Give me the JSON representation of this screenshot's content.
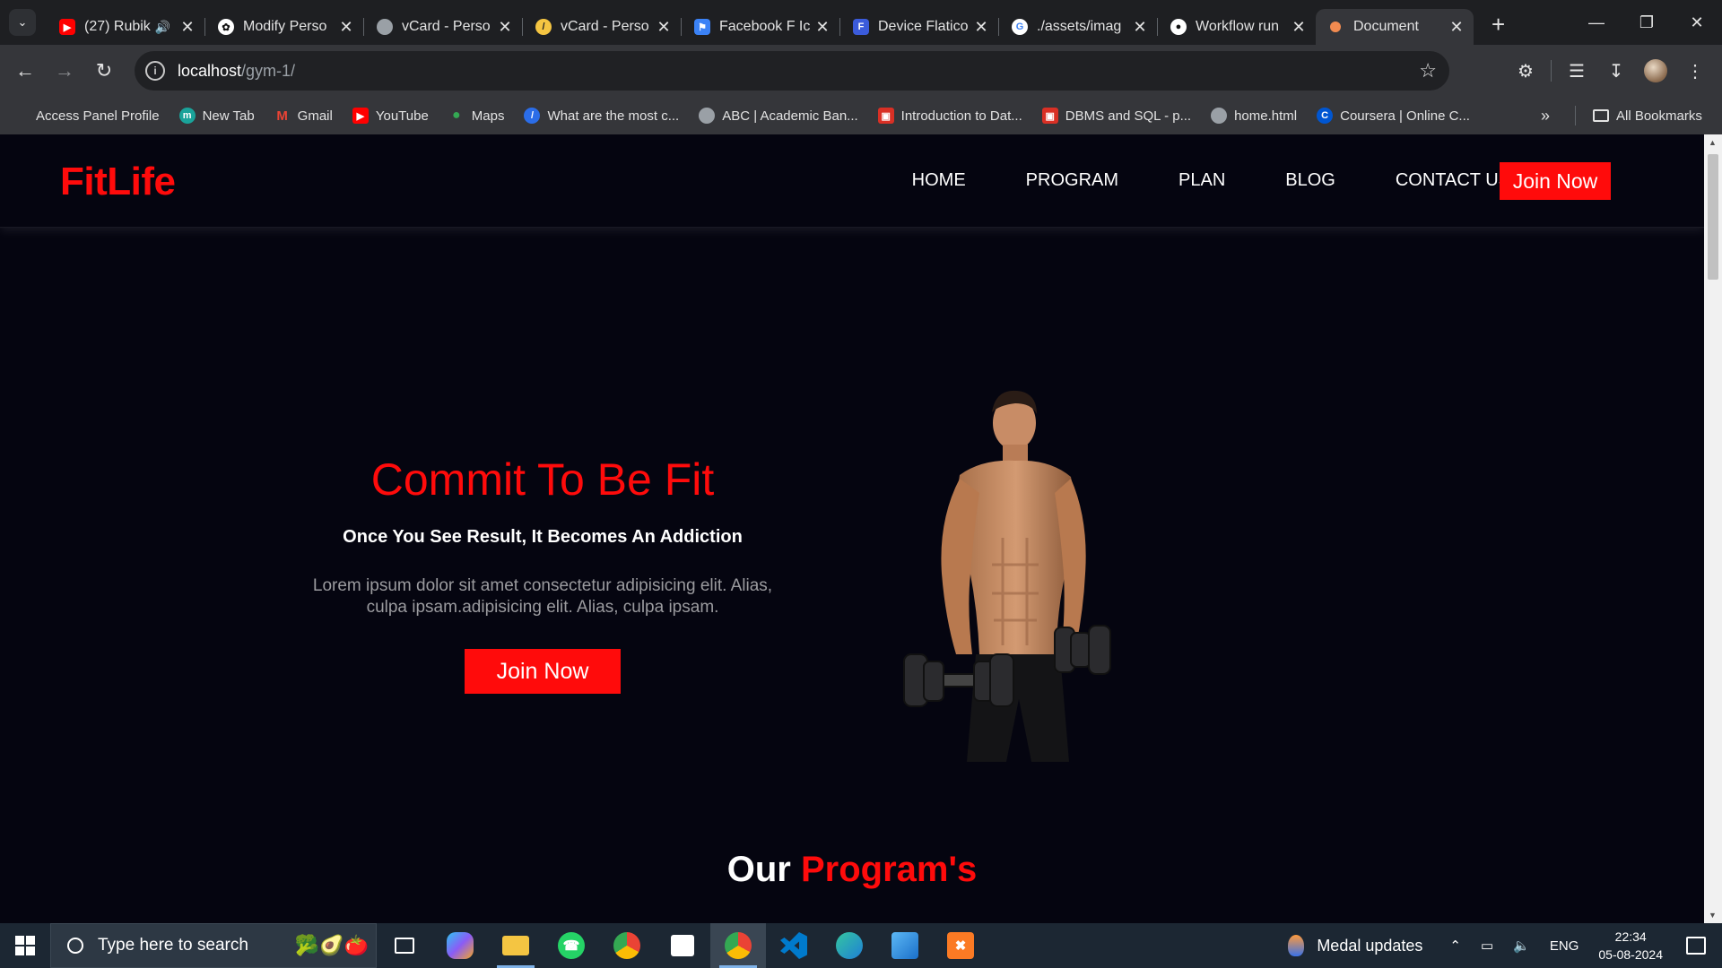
{
  "browser": {
    "tabs": [
      {
        "title": "(27) Rubik",
        "favicon": "youtube-icon",
        "color": "#ff0000",
        "muted_speaker": true
      },
      {
        "title": "Modify Perso",
        "favicon": "chatgpt-icon",
        "color": "#ffffff"
      },
      {
        "title": "vCard - Perso",
        "favicon": "globe-icon",
        "color": "#9aa0a6"
      },
      {
        "title": "vCard - Perso",
        "favicon": "pen-icon",
        "color": "#f5c542"
      },
      {
        "title": "Facebook F Ic",
        "favicon": "flag-icon",
        "color": "#3b82f6"
      },
      {
        "title": "Device Flatico",
        "favicon": "flaticon-icon",
        "color": "#3b5bdb"
      },
      {
        "title": "./assets/imag",
        "favicon": "google-icon",
        "color": "#ffffff"
      },
      {
        "title": "Workflow run",
        "favicon": "github-icon",
        "color": "#ffffff"
      },
      {
        "title": "Document",
        "favicon": "document-icon",
        "color": "#f28b50",
        "active": true
      }
    ],
    "address": {
      "host": "localhost",
      "path": "/gym-1/"
    },
    "bookmarks": [
      {
        "label": "Access Panel Profile",
        "icon": "microsoft-icon",
        "color": "#f25022"
      },
      {
        "label": "New Tab",
        "icon": "newtab-icon",
        "color": "#1aa39a"
      },
      {
        "label": "Gmail",
        "icon": "gmail-icon",
        "color": "#ea4335"
      },
      {
        "label": "YouTube",
        "icon": "youtube-icon",
        "color": "#ff0000"
      },
      {
        "label": "Maps",
        "icon": "maps-icon",
        "color": "#34a853"
      },
      {
        "label": "What are the most c...",
        "icon": "quora-icon",
        "color": "#2b6de8"
      },
      {
        "label": "ABC | Academic Ban...",
        "icon": "globe-icon",
        "color": "#9aa0a6"
      },
      {
        "label": "Introduction to Dat...",
        "icon": "slides-icon",
        "color": "#d93025"
      },
      {
        "label": "DBMS and SQL - p...",
        "icon": "slides-icon",
        "color": "#d93025"
      },
      {
        "label": "home.html",
        "icon": "globe-icon",
        "color": "#9aa0a6"
      },
      {
        "label": "Coursera | Online C...",
        "icon": "coursera-icon",
        "color": "#0056d2"
      }
    ],
    "all_bookmarks_label": "All Bookmarks"
  },
  "site": {
    "logo": "FitLife",
    "nav": [
      "HOME",
      "PROGRAM",
      "PLAN",
      "BLOG",
      "CONTACT US"
    ],
    "nav_join": "Join Now",
    "hero": {
      "title": "Commit To Be Fit",
      "subtitle": "Once You See Result, It Becomes An Addiction",
      "text": "Lorem ipsum dolor sit amet consectetur adipisicing elit. Alias, culpa ipsam.adipisicing elit. Alias, culpa ipsam.",
      "button": "Join Now"
    },
    "programs_title_white": "Our",
    "programs_title_red": "Program's",
    "accent_color": "#ff0b0b"
  },
  "taskbar": {
    "search_placeholder": "Type here to search",
    "apps": [
      "task-view-icon",
      "copilot-icon",
      "file-explorer-icon",
      "whatsapp-icon",
      "chrome-icon",
      "store-icon",
      "chrome-profile-icon",
      "vscode-icon",
      "edge-icon",
      "photos-icon",
      "xampp-icon"
    ],
    "medal_label": "Medal updates",
    "lang": "ENG",
    "time": "22:34",
    "date": "05-08-2024"
  }
}
